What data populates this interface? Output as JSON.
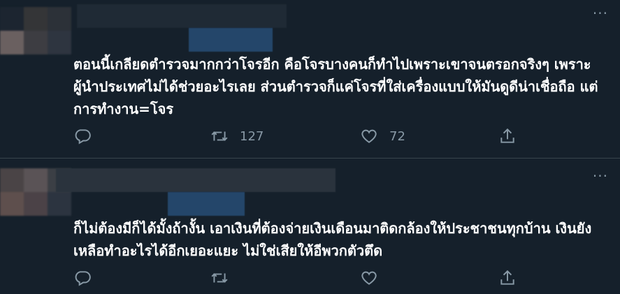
{
  "tweets": [
    {
      "text": "ตอนนี้เกลียดตำรวจมากกว่าโจรอีก คือโจรบางคนก็ทำไปเพราะเขาจนตรอกจริงๆ เพราะผู้นำประเทศไม่ได้ช่วยอะไรเลย ส่วนตำรวจก็แค่โจรที่ใส่เครื่องแบบให้มันดูดีน่าเชื่อถือ แต่การทำงาน=โจร",
      "retweets": "127",
      "likes": "72"
    },
    {
      "text": "ก็ไม่ต้องมีก็ได้มั้งถ้างั้น เอาเงินที่ต้องจ่ายเงินเดือนมาติดกล้องให้ประชาชนทุกบ้าน เงินยังเหลือทำอะไรได้อีกเยอะแยะ ไม่ใช่เสียให้อีพวกตัวตึด",
      "retweets": "",
      "likes": ""
    }
  ],
  "icons": {
    "reply": "reply-icon",
    "retweet": "retweet-icon",
    "like": "heart-icon",
    "share": "share-icon",
    "more": "more-icon"
  },
  "colors": {
    "background": "#15202b",
    "text": "#ffffff",
    "muted": "#8899a6",
    "divider": "#38444d"
  }
}
